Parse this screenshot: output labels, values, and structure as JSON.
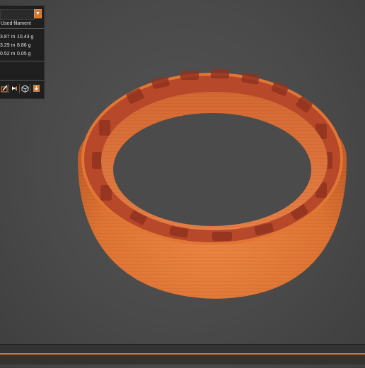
{
  "filament_panel": {
    "column_header": "Used filament",
    "rows": [
      {
        "length": "3.87 m",
        "weight": "10.43 g"
      },
      {
        "length": "3.29 m",
        "weight": "8.86 g"
      },
      {
        "length": "0.52 m",
        "weight": "0.05 g"
      }
    ]
  },
  "toolbar": {
    "icons": [
      "slice-edit-icon",
      "paint-icon",
      "cube-view-icon",
      "export-icon"
    ]
  },
  "colors": {
    "accent": "#d9752e",
    "model_orange": "#e57a3a",
    "model_inner_red": "#b5462a",
    "background": "#4a4a4a",
    "panel": "#1f1f1f"
  }
}
